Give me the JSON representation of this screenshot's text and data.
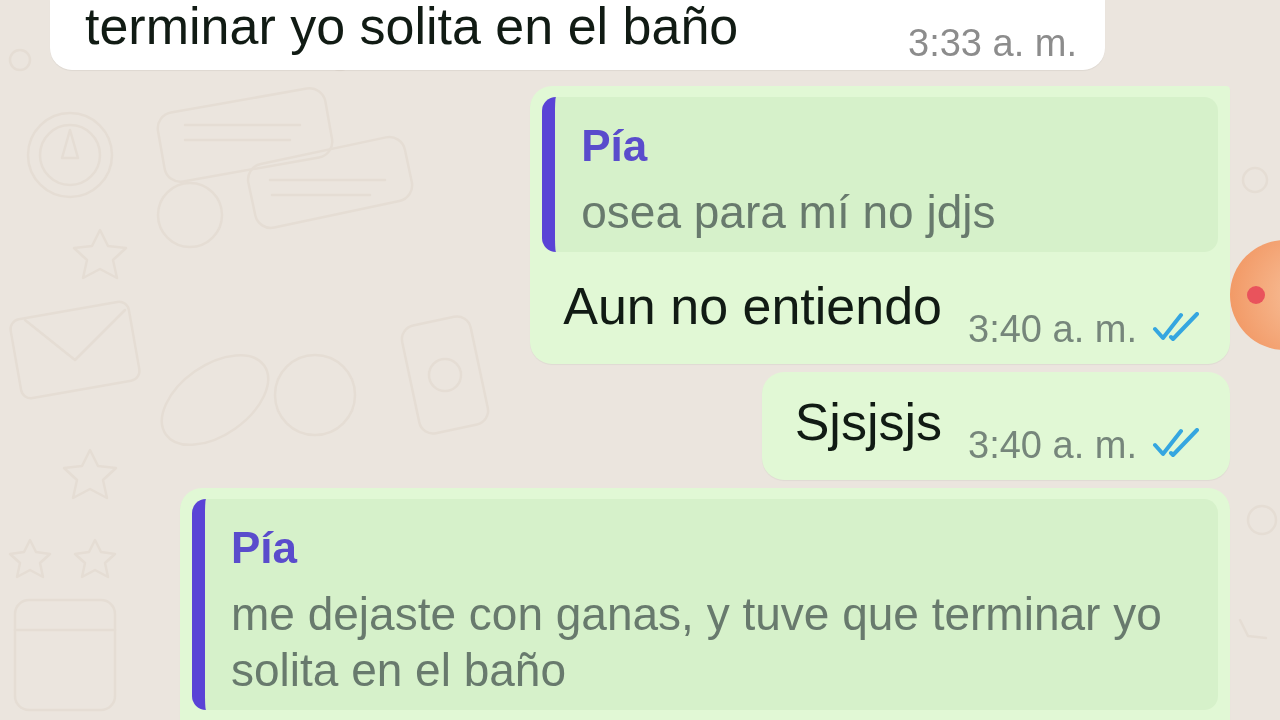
{
  "messages": [
    {
      "kind": "incoming",
      "text": "terminar yo solita en el baño",
      "time": "3:33 a. m."
    },
    {
      "kind": "outgoing",
      "quote": {
        "author": "Pía",
        "text": "osea para mí no jdjs"
      },
      "text": "Aun no entiendo",
      "time": "3:40 a. m.",
      "read": true
    },
    {
      "kind": "outgoing",
      "text": "Sjsjsjs",
      "time": "3:40 a. m.",
      "read": true
    },
    {
      "kind": "outgoing",
      "quote": {
        "author": "Pía",
        "text": "me dejaste con ganas, y tuve que terminar yo solita en el baño"
      }
    }
  ]
}
